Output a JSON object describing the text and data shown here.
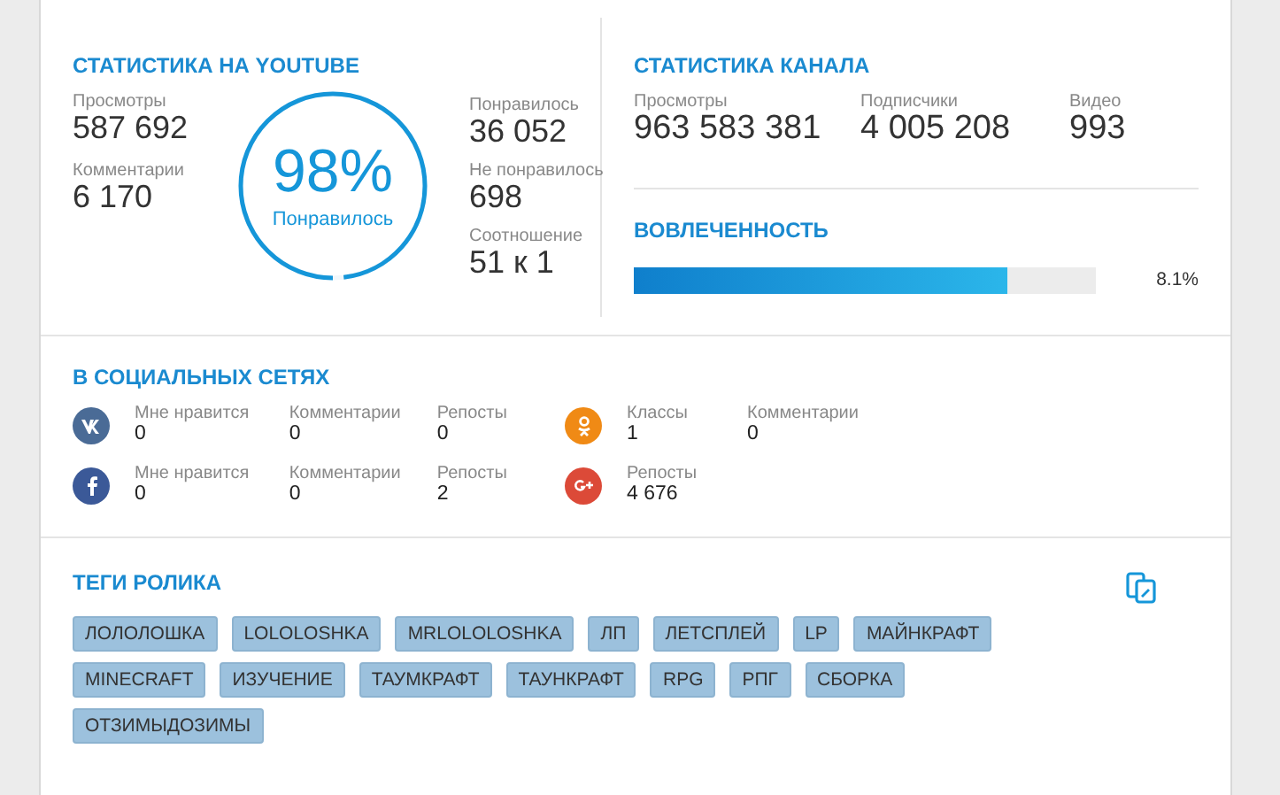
{
  "youtube_stats": {
    "title": "СТАТИСТИКА НА YOUTUBE",
    "left": [
      {
        "label": "Просмотры",
        "value": "587 692"
      },
      {
        "label": "Комментарии",
        "value": "6 170"
      }
    ],
    "ring": {
      "value": "98%",
      "label": "Понравилось",
      "level": 0.98
    },
    "right": [
      {
        "label": "Понравилось",
        "value": "36 052"
      },
      {
        "label": "Не понравилось",
        "value": "698"
      },
      {
        "label": "Соотношение",
        "value": "51 к 1"
      }
    ]
  },
  "channel_stats": {
    "title": "СТАТИСТИКА КАНАЛА",
    "items": [
      {
        "label": "Просмотры",
        "value": "963 583 381"
      },
      {
        "label": "Подписчики",
        "value": "4 005 208"
      },
      {
        "label": "Видео",
        "value": "993"
      }
    ],
    "engagement": {
      "title": "ВОВЛЕЧЕННОСТЬ",
      "level": 0.81,
      "reading": "8.1%"
    }
  },
  "social": {
    "title": "В СОЦИАЛЬНЫХ СЕТЯХ",
    "rows": [
      {
        "groups": [
          {
            "kind": "vk",
            "stats": [
              {
                "label": "Мне нравится",
                "value": "0"
              },
              {
                "label": "Комментарии",
                "value": "0"
              },
              {
                "label": "Репосты",
                "value": "0"
              }
            ]
          },
          {
            "kind": "ok",
            "stats": [
              {
                "label": "Классы",
                "value": "1"
              },
              {
                "label": "Комментарии",
                "value": "0"
              }
            ]
          }
        ]
      },
      {
        "groups": [
          {
            "kind": "facebook",
            "stats": [
              {
                "label": "Мне нравится",
                "value": "0"
              },
              {
                "label": "Комментарии",
                "value": "0"
              },
              {
                "label": "Репосты",
                "value": "2"
              }
            ]
          },
          {
            "kind": "gplus",
            "stats": [
              {
                "label": "Репосты",
                "value": "4 676"
              }
            ]
          }
        ]
      }
    ]
  },
  "tags": {
    "title": "ТЕГИ РОЛИКА",
    "items": [
      "ЛОЛОЛОШКА",
      "LOLOLOSHKA",
      "MRLOLOLOSHKA",
      "ЛП",
      "ЛЕТСПЛЕЙ",
      "LP",
      "МАЙНКРАФТ",
      "MINECRAFT",
      "ИЗУЧЕНИЕ",
      "ТАУМКРАФТ",
      "ТАУНКРАФТ",
      "RPG",
      "РПГ",
      "СБОРКА",
      "ОТЗИМЫДОЗИМЫ"
    ]
  }
}
